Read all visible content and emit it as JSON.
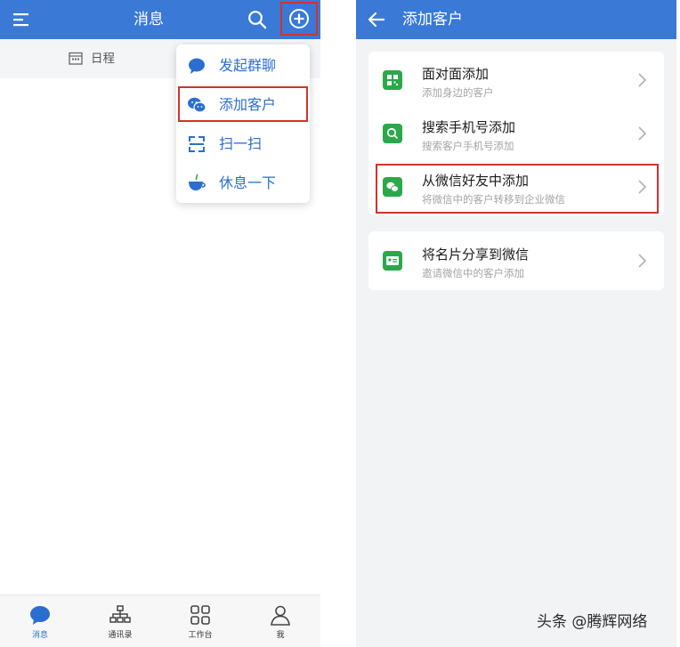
{
  "left": {
    "title": "消息",
    "sub_tab_label": "日程",
    "menu": {
      "items": [
        {
          "label": "发起群聊",
          "icon": "chat-bubble-icon"
        },
        {
          "label": "添加客户",
          "icon": "wechat-icon"
        },
        {
          "label": "扫一扫",
          "icon": "scan-icon"
        },
        {
          "label": "休息一下",
          "icon": "coffee-cup-icon"
        }
      ]
    },
    "tabs": [
      {
        "label": "消息",
        "icon": "message-icon",
        "active": true
      },
      {
        "label": "通讯录",
        "icon": "org-chart-icon",
        "active": false
      },
      {
        "label": "工作台",
        "icon": "grid-icon",
        "active": false
      },
      {
        "label": "我",
        "icon": "person-icon",
        "active": false
      }
    ]
  },
  "right": {
    "title": "添加客户",
    "rows": [
      {
        "title": "面对面添加",
        "subtitle": "添加身边的客户",
        "icon": "qr-code-icon"
      },
      {
        "title": "搜索手机号添加",
        "subtitle": "搜索客户手机号添加",
        "icon": "search-icon"
      },
      {
        "title": "从微信好友中添加",
        "subtitle": "将微信中的客户转移到企业微信",
        "icon": "wechat-icon"
      },
      {
        "title": "将名片分享到微信",
        "subtitle": "邀请微信中的客户添加",
        "icon": "business-card-icon"
      }
    ]
  },
  "watermark": "头条 @腾辉网络",
  "colors": {
    "header_blue": "#3a79d6",
    "menu_blue": "#2a6fcf",
    "highlight_red": "#d0342c",
    "icon_green": "#2aa84a"
  }
}
